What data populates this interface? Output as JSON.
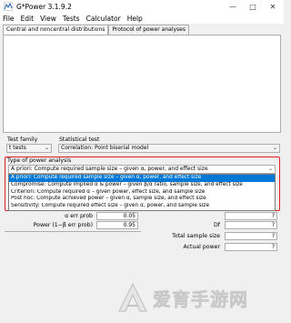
{
  "window": {
    "title": "G*Power 3.1.9.2"
  },
  "menu": [
    "File",
    "Edit",
    "View",
    "Tests",
    "Calculator",
    "Help"
  ],
  "tabs": [
    "Central and noncentral distributions",
    "Protocol of power analyses"
  ],
  "test_family": {
    "label": "Test family",
    "value": "t tests"
  },
  "statistical_test": {
    "label": "Statistical test",
    "value": "Correlation: Point biserial model"
  },
  "analysis": {
    "label": "Type of power analysis",
    "value": "A priori: Compute required sample size – given α, power, and effect size",
    "options": [
      "A priori: Compute required sample size – given α, power, and effect size",
      "Compromise: Compute implied α & power – given β/α ratio, sample size, and effect size",
      "Criterion: Compute required α – given power, effect size, and sample size",
      "Post hoc: Compute achieved power – given α, sample size, and effect size",
      "Sensitivity: Compute required effect size – given α, power, and sample size"
    ],
    "selected_index": 0
  },
  "input": {
    "alpha": {
      "label": "α err prob",
      "value": "0.05"
    },
    "power": {
      "label": "Power (1−β err prob)",
      "value": "0.95"
    }
  },
  "output": {
    "top": {
      "value": "?"
    },
    "df": {
      "label": "Df",
      "value": "?"
    },
    "total_n": {
      "label": "Total sample size",
      "value": "?"
    },
    "actual_power": {
      "label": "Actual power",
      "value": "?"
    }
  },
  "watermark": {
    "text": "爱育手游网"
  },
  "colors": {
    "highlight": "#e02020",
    "selection": "#0078d7",
    "watermark": "#c8c8c8"
  }
}
